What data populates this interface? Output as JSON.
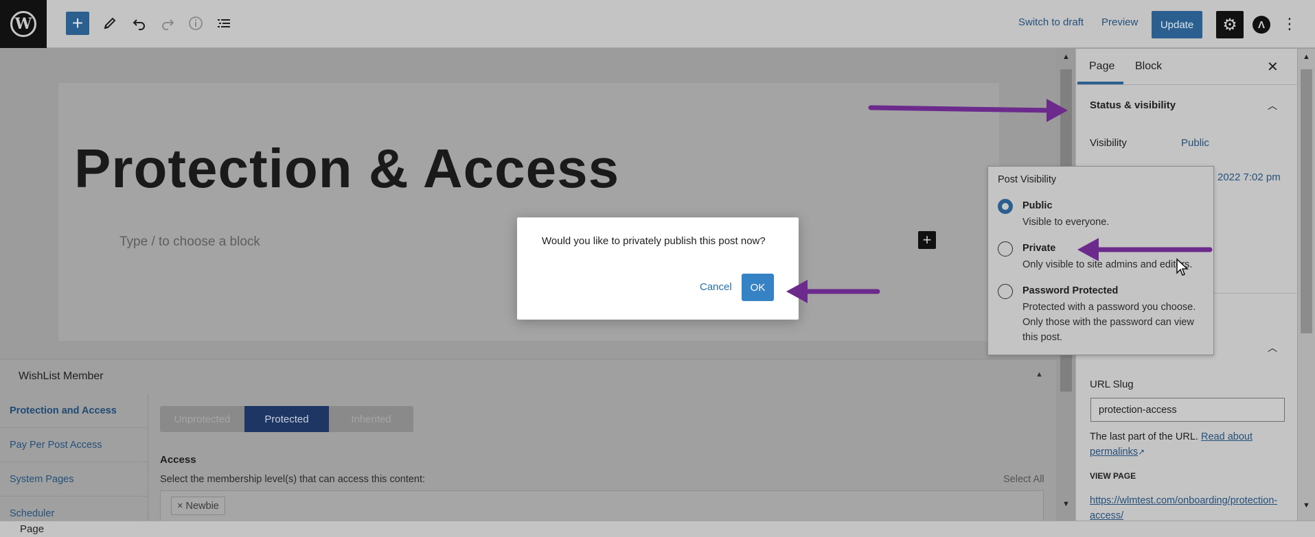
{
  "toolbar": {
    "switch_draft": "Switch to draft",
    "preview": "Preview",
    "update": "Update"
  },
  "editor": {
    "title": "Protection & Access",
    "block_placeholder": "Type / to choose a block"
  },
  "dialog": {
    "message": "Would you like to privately publish this post now?",
    "cancel": "Cancel",
    "ok": "OK"
  },
  "wishlist": {
    "title": "WishList Member",
    "nav": [
      "Protection and Access",
      "Pay Per Post Access",
      "System Pages",
      "Scheduler"
    ],
    "segments": [
      "Unprotected",
      "Protected",
      "Inherited"
    ],
    "active_segment": "Protected",
    "access_heading": "Access",
    "access_desc": "Select the membership level(s) that can access this content:",
    "select_all": "Select All",
    "levels": [
      "× Newbie"
    ]
  },
  "footer": {
    "breadcrumb": "Page"
  },
  "sidebar": {
    "tabs": [
      "Page",
      "Block"
    ],
    "active_tab": "Page",
    "status_title": "Status & visibility",
    "visibility_label": "Visibility",
    "visibility_value": "Public",
    "publish_partial": "2022 7:02 pm",
    "url_slug_label": "URL Slug",
    "url_slug_value": "protection-access",
    "slug_help_text": "The last part of the URL.",
    "slug_help_link": "Read about permalinks",
    "view_page_label": "VIEW PAGE",
    "view_page_link": "https://wlmtest.com/onboarding/protection-access/"
  },
  "visibility_popover": {
    "title": "Post Visibility",
    "options": [
      {
        "label": "Public",
        "desc": "Visible to everyone.",
        "selected": true
      },
      {
        "label": "Private",
        "desc": "Only visible to site admins and editors.",
        "selected": false
      },
      {
        "label": "Password Protected",
        "desc": "Protected with a password you choose. Only those with the password can view this post.",
        "selected": false
      }
    ]
  },
  "colors": {
    "accent": "#2a5f8f",
    "annotation_arrow": "#6b2a8c",
    "dialog_ok": "#3582c4"
  }
}
